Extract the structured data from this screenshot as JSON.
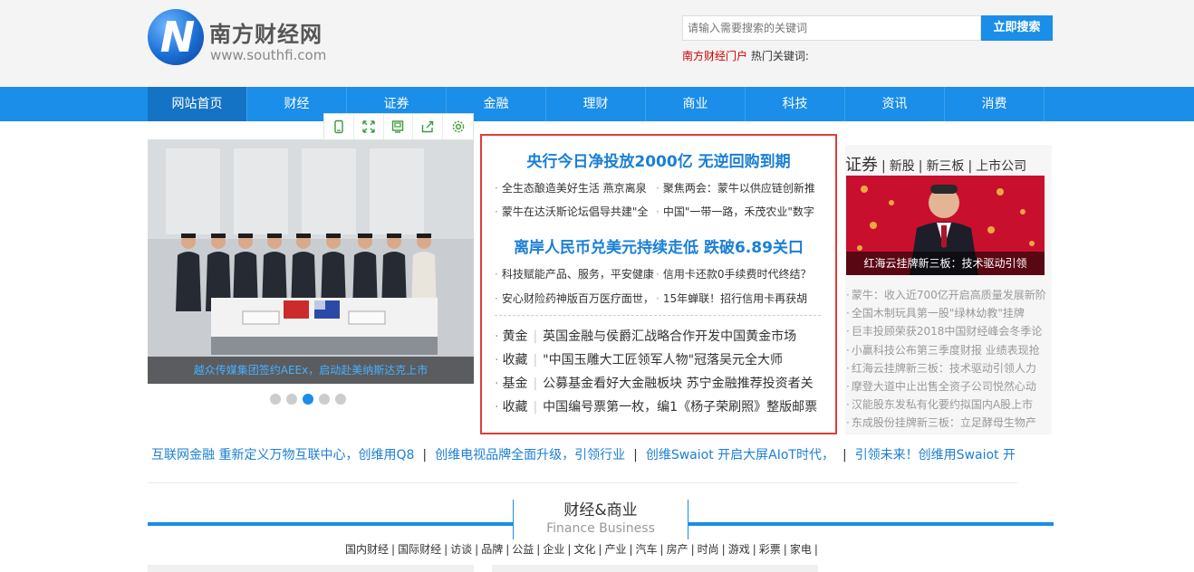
{
  "site": {
    "title": "南方财经网",
    "url": "www.southfi.com"
  },
  "search": {
    "placeholder": "请输入需要搜索的关键词",
    "button": "立即搜索"
  },
  "hot": {
    "portal": "南方财经门户",
    "label": "热门关键词:"
  },
  "nav": [
    {
      "label": "网站首页",
      "active": true
    },
    {
      "label": "财经"
    },
    {
      "label": "证券"
    },
    {
      "label": "金融"
    },
    {
      "label": "理财"
    },
    {
      "label": "商业"
    },
    {
      "label": "科技"
    },
    {
      "label": "资讯"
    },
    {
      "label": "消费"
    }
  ],
  "toolbar": [
    "mobile-icon",
    "expand-icon",
    "save-icon",
    "share-icon",
    "settings-icon"
  ],
  "slide": {
    "caption": "越众传媒集团签约AEEx，启动赴美纳斯达克上市",
    "dots": 5,
    "active_dot": 3
  },
  "center": {
    "headline1": "央行今日净投放2000亿 无逆回购到期",
    "rows1": [
      [
        "全生态酿造美好生活 燕京离泉",
        "聚焦两会：蒙牛以供应链创新推"
      ],
      [
        "蒙牛在达沃斯论坛倡导共建\"全",
        "中国\"一带一路，禾茂农业\"数字"
      ]
    ],
    "headline2": "离岸人民币兑美元持续走低 跌破6.89关口",
    "rows2": [
      [
        "科技赋能产品、服务，平安健康",
        "信用卡还款0手续费时代终结？"
      ],
      [
        "安心财险药神版百万医疗面世，",
        "15年蝉联！招行信用卡再获胡"
      ]
    ],
    "cats": [
      {
        "cat": "黄金",
        "text": "英国金融与侯爵汇战略合作开发中国黄金市场"
      },
      {
        "cat": "收藏",
        "text": "\"中国玉雕大工匠领军人物\"冠落吴元全大师"
      },
      {
        "cat": "基金",
        "text": "公募基金看好大金融板块 苏宁金融推荐投资者关"
      },
      {
        "cat": "收藏",
        "text": "中国编号票第一枚，编1《杨子荣刷照》整版邮票"
      }
    ]
  },
  "right": {
    "head_main": "证券",
    "head_links": [
      "新股",
      "新三板",
      "上市公司"
    ],
    "image_caption": "红海云挂牌新三板：技术驱动引领",
    "list": [
      "蒙牛：收入近700亿开启高质量发展新阶",
      "全国木制玩具第一股\"绿林幼教\"挂牌",
      "巨丰投顾荣获2018中国财经峰会冬季论",
      "小赢科技公布第三季度财报 业绩表现抢",
      "红海云挂牌新三板：技术驱动引领人力",
      "摩登大道中止出售全资子公司悦然心动",
      "汉能股东发私有化要约拟国内A股上市",
      "东成股份挂牌新三板：立足酵母生物产"
    ]
  },
  "ticker": [
    "互联网金融  重新定义万物互联中心，创维用Q8",
    "创维电视品牌全面升级，引领行业",
    "创维Swaiot 开启大屏AIoT时代，",
    "引领未来！创维用Swaiot 开"
  ],
  "section": {
    "title_cn": "财经&商业",
    "title_en": "Finance Business",
    "subcats": [
      "国内财经",
      "国际财经",
      "访谈",
      "品牌",
      "公益",
      "企业",
      "文化",
      "产业",
      "汽车",
      "房产",
      "时尚",
      "游戏",
      "彩票",
      "家电"
    ]
  }
}
